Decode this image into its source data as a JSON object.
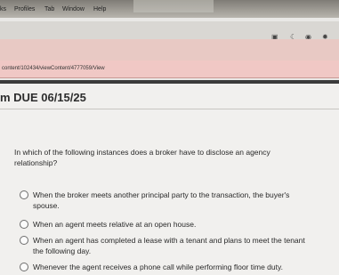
{
  "menubar": {
    "items": [
      "ks",
      "Profiles",
      "Tab",
      "Window",
      "Help"
    ]
  },
  "browser": {
    "url": "content/102434/viewContent/4777059/View"
  },
  "page": {
    "heading": "m DUE 06/15/25"
  },
  "quiz": {
    "question": "In which of the following instances does a broker have to disclose an agency relationship?",
    "options": [
      "When the broker meets another principal party to the transaction, the buyer's spouse.",
      "When an agent meets  relative at an open house.",
      "When an agent has completed a lease with a tenant and plans to meet the tenant the following day.",
      "Whenever the agent receives a phone call while performing floor time duty."
    ]
  }
}
